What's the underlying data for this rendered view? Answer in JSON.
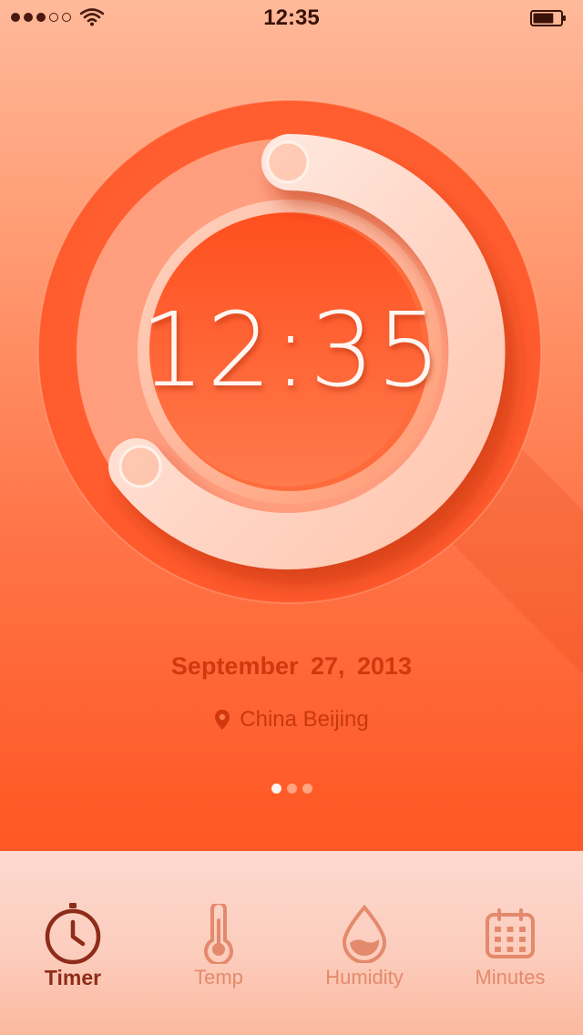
{
  "status_bar": {
    "time": "12:35",
    "signal_bars_filled": 3,
    "signal_bars_total": 5,
    "battery_level": 0.75,
    "wifi_icon": "wifi-icon",
    "battery_icon": "battery-icon"
  },
  "clock": {
    "time": "12:35"
  },
  "date": "September 27, 2013",
  "location": {
    "icon": "location-pin-icon",
    "text": "China Beijing"
  },
  "pager": {
    "pages": 3,
    "active_index": 0
  },
  "tabs": [
    {
      "label": "Timer",
      "icon": "clock-icon",
      "active": true
    },
    {
      "label": "Temp",
      "icon": "thermometer-icon",
      "active": false
    },
    {
      "label": "Humidity",
      "icon": "water-drop-icon",
      "active": false
    },
    {
      "label": "Minutes",
      "icon": "calendar-icon",
      "active": false
    }
  ],
  "colors": {
    "accent": "#ff5a28",
    "active_tab": "#8e2c1a",
    "inactive_tab": "#e48a6c",
    "date_text": "#d2380f"
  }
}
